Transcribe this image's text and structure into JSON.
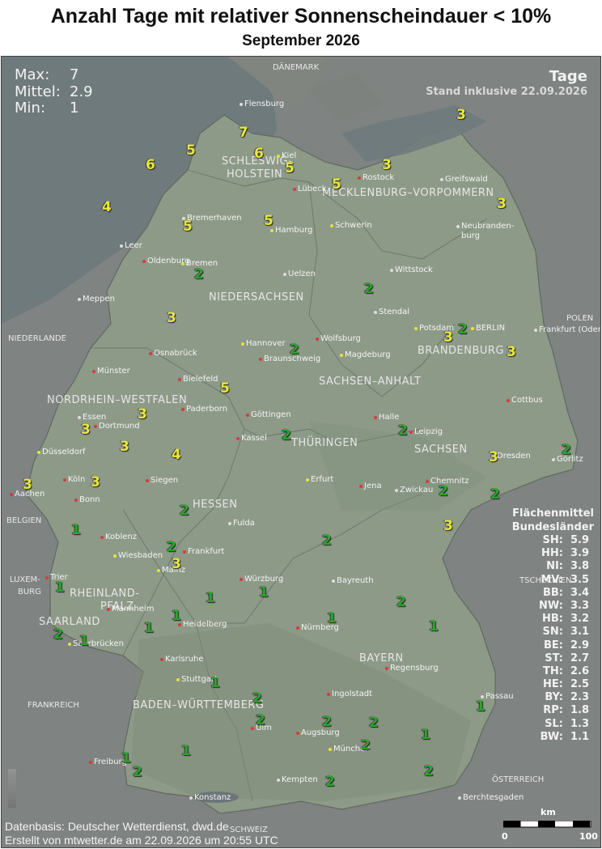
{
  "header": {
    "title": "Anzahl Tage mit relativer Sonnenscheindauer < 10%",
    "subtitle": "September 2026"
  },
  "stats": {
    "max_label": "Max:",
    "max_value": "7",
    "mean_label": "Mittel:",
    "mean_value": "2.9",
    "min_label": "Min:",
    "min_value": "1"
  },
  "unit": "Tage",
  "stand": "Stand inklusive 22.09.2026",
  "colors": {
    "sea": "#6c7679",
    "land_other": "#808080",
    "germany": "#8c9a88",
    "value_high": "#e8e83a",
    "value_low": "#2ea32e",
    "dot_red": "#d43b3b",
    "dot_yellow": "#e4e43c",
    "dot_gray": "#dddddd"
  },
  "regions": [
    {
      "name": "SCHLESWIG-",
      "cls": "r1"
    },
    {
      "name": "HOLSTEIN",
      "cls": "r2"
    },
    {
      "name": "MECKLENBURG–VORPOMMERN",
      "cls": "r3"
    },
    {
      "name": "NIEDERSACHSEN",
      "cls": "r4"
    },
    {
      "name": "BRANDENBURG",
      "cls": "r5"
    },
    {
      "name": "SACHSEN–ANHALT",
      "cls": "r6"
    },
    {
      "name": "NORDRHEIN–WESTFALEN",
      "cls": "r7"
    },
    {
      "name": "THÜRINGEN",
      "cls": "r8"
    },
    {
      "name": "SACHSEN",
      "cls": "r9"
    },
    {
      "name": "HESSEN",
      "cls": "r10"
    },
    {
      "name": "RHEINLAND-",
      "cls": "r11"
    },
    {
      "name": "PFALZ",
      "cls": "r12"
    },
    {
      "name": "SAARLAND",
      "cls": "r13"
    },
    {
      "name": "BAYERN",
      "cls": "r14"
    },
    {
      "name": "BADEN–WÜRTTEMBERG",
      "cls": "r15"
    }
  ],
  "countries": [
    {
      "name": "DÄNEMARK"
    },
    {
      "name": "NIEDERLANDE"
    },
    {
      "name": "POLEN"
    },
    {
      "name": "BELGIEN"
    },
    {
      "name": "LUXEM-"
    },
    {
      "name": "BURG"
    },
    {
      "name": "FRANKREICH"
    },
    {
      "name": "ÖSTERREICH"
    },
    {
      "name": "SCHWEIZ"
    },
    {
      "name": "TSCHECHIEN"
    }
  ],
  "cities": [
    {
      "name": "Flensburg",
      "dot": "gray"
    },
    {
      "name": "Kiel",
      "dot": "yellow"
    },
    {
      "name": "Rostock",
      "dot": "red"
    },
    {
      "name": "Greifswald",
      "dot": "gray"
    },
    {
      "name": "Lübeck",
      "dot": "red"
    },
    {
      "name": "Schwerin",
      "dot": "yellow"
    },
    {
      "name": "Hamburg",
      "dot": "yellow"
    },
    {
      "name": "Bremerhaven",
      "dot": "gray"
    },
    {
      "name": "Neubranden-",
      "dot": "gray"
    },
    {
      "name": "burg",
      "dot": "none"
    },
    {
      "name": "Leer",
      "dot": "gray"
    },
    {
      "name": "Oldenburg",
      "dot": "red"
    },
    {
      "name": "Bremen",
      "dot": "yellow"
    },
    {
      "name": "Wittstock",
      "dot": "gray"
    },
    {
      "name": "Uelzen",
      "dot": "gray"
    },
    {
      "name": "Meppen",
      "dot": "gray"
    },
    {
      "name": "Stendal",
      "dot": "gray"
    },
    {
      "name": "Potsdam",
      "dot": "yellow"
    },
    {
      "name": "BERLIN",
      "dot": "yellow"
    },
    {
      "name": "Frankfurt (Oder)",
      "dot": "gray"
    },
    {
      "name": "Hannover",
      "dot": "yellow"
    },
    {
      "name": "Wolfsburg",
      "dot": "red"
    },
    {
      "name": "Osnabrück",
      "dot": "red"
    },
    {
      "name": "Braunschweig",
      "dot": "red"
    },
    {
      "name": "Magdeburg",
      "dot": "yellow"
    },
    {
      "name": "Münster",
      "dot": "red"
    },
    {
      "name": "Bielefeld",
      "dot": "red"
    },
    {
      "name": "Cottbus",
      "dot": "red"
    },
    {
      "name": "Paderborn",
      "dot": "red"
    },
    {
      "name": "Essen",
      "dot": "gray"
    },
    {
      "name": "Dortmund",
      "dot": "red"
    },
    {
      "name": "Göttingen",
      "dot": "red"
    },
    {
      "name": "Halle",
      "dot": "red"
    },
    {
      "name": "Leipzig",
      "dot": "red"
    },
    {
      "name": "Düsseldorf",
      "dot": "yellow"
    },
    {
      "name": "Kassel",
      "dot": "red"
    },
    {
      "name": "Dresden",
      "dot": "yellow"
    },
    {
      "name": "Görlitz",
      "dot": "gray"
    },
    {
      "name": "Köln",
      "dot": "red"
    },
    {
      "name": "Siegen",
      "dot": "red"
    },
    {
      "name": "Erfurt",
      "dot": "yellow"
    },
    {
      "name": "Jena",
      "dot": "red"
    },
    {
      "name": "Chemnitz",
      "dot": "red"
    },
    {
      "name": "Aachen",
      "dot": "red"
    },
    {
      "name": "Bonn",
      "dot": "red"
    },
    {
      "name": "Zwickau",
      "dot": "gray"
    },
    {
      "name": "Fulda",
      "dot": "gray"
    },
    {
      "name": "Koblenz",
      "dot": "red"
    },
    {
      "name": "Wiesbaden",
      "dot": "yellow"
    },
    {
      "name": "Frankfurt",
      "dot": "red"
    },
    {
      "name": "Mainz",
      "dot": "yellow"
    },
    {
      "name": "Bayreuth",
      "dot": "gray"
    },
    {
      "name": "Trier",
      "dot": "red"
    },
    {
      "name": "Würzburg",
      "dot": "red"
    },
    {
      "name": "Mannheim",
      "dot": "red"
    },
    {
      "name": "Heidelberg",
      "dot": "red"
    },
    {
      "name": "Nürnberg",
      "dot": "red"
    },
    {
      "name": "Saarbrücken",
      "dot": "yellow"
    },
    {
      "name": "Regensburg",
      "dot": "red"
    },
    {
      "name": "Karlsruhe",
      "dot": "red"
    },
    {
      "name": "Stuttgart",
      "dot": "yellow"
    },
    {
      "name": "Ingolstadt",
      "dot": "red"
    },
    {
      "name": "Passau",
      "dot": "gray"
    },
    {
      "name": "Ulm",
      "dot": "red"
    },
    {
      "name": "Augsburg",
      "dot": "red"
    },
    {
      "name": "München",
      "dot": "yellow"
    },
    {
      "name": "Freiburg",
      "dot": "red"
    },
    {
      "name": "Kempten",
      "dot": "gray"
    },
    {
      "name": "Konstanz",
      "dot": "gray"
    },
    {
      "name": "Berchtesgaden",
      "dot": "gray"
    }
  ],
  "stations": [
    {
      "v": "3"
    },
    {
      "v": "7"
    },
    {
      "v": "5"
    },
    {
      "v": "6"
    },
    {
      "v": "6"
    },
    {
      "v": "5"
    },
    {
      "v": "3"
    },
    {
      "v": "5"
    },
    {
      "v": "3"
    },
    {
      "v": "4"
    },
    {
      "v": "5"
    },
    {
      "v": "5"
    },
    {
      "v": "2"
    },
    {
      "v": "2"
    },
    {
      "v": "3"
    },
    {
      "v": "3"
    },
    {
      "v": "2"
    },
    {
      "v": "3"
    },
    {
      "v": "2"
    },
    {
      "v": "5"
    },
    {
      "v": "3"
    },
    {
      "v": "3"
    },
    {
      "v": "2"
    },
    {
      "v": "3"
    },
    {
      "v": "4"
    },
    {
      "v": "2"
    },
    {
      "v": "3"
    },
    {
      "v": "2"
    },
    {
      "v": "3"
    },
    {
      "v": "2"
    },
    {
      "v": "3"
    },
    {
      "v": "2"
    },
    {
      "v": "2"
    },
    {
      "v": "2"
    },
    {
      "v": "1"
    },
    {
      "v": "3"
    },
    {
      "v": "2"
    },
    {
      "v": "3"
    },
    {
      "v": "1"
    },
    {
      "v": "1"
    },
    {
      "v": "1"
    },
    {
      "v": "2"
    },
    {
      "v": "1"
    },
    {
      "v": "1"
    },
    {
      "v": "1"
    },
    {
      "v": "1"
    },
    {
      "v": "2"
    },
    {
      "v": "1"
    },
    {
      "v": "1"
    },
    {
      "v": "2"
    },
    {
      "v": "2"
    },
    {
      "v": "2"
    },
    {
      "v": "2"
    },
    {
      "v": "1"
    },
    {
      "v": "1"
    },
    {
      "v": "1"
    },
    {
      "v": "2"
    },
    {
      "v": "2"
    },
    {
      "v": "1"
    },
    {
      "v": "2"
    },
    {
      "v": "2"
    }
  ],
  "state_means": {
    "title_line1": "Flächenmittel",
    "title_line2": "Bundesländer",
    "rows": [
      {
        "k": "SH:",
        "v": "5.9"
      },
      {
        "k": "HH:",
        "v": "3.9"
      },
      {
        "k": "NI:",
        "v": "3.8"
      },
      {
        "k": "MV:",
        "v": "3.5"
      },
      {
        "k": "BB:",
        "v": "3.4"
      },
      {
        "k": "NW:",
        "v": "3.3"
      },
      {
        "k": "HB:",
        "v": "3.2"
      },
      {
        "k": "SN:",
        "v": "3.1"
      },
      {
        "k": "BE:",
        "v": "2.9"
      },
      {
        "k": "ST:",
        "v": "2.7"
      },
      {
        "k": "TH:",
        "v": "2.6"
      },
      {
        "k": "HE:",
        "v": "2.5"
      },
      {
        "k": "BY:",
        "v": "2.3"
      },
      {
        "k": "RP:",
        "v": "1.8"
      },
      {
        "k": "SL:",
        "v": "1.3"
      },
      {
        "k": "BW:",
        "v": "1.1"
      }
    ]
  },
  "scale": {
    "label": "km",
    "min": "0",
    "max": "100"
  },
  "footer": {
    "line1": "Datenbasis: Deutscher Wetterdienst, dwd.de",
    "line2": "Erstellt von mtwetter.de am 22.09.2026 um 20:55 UTC"
  }
}
